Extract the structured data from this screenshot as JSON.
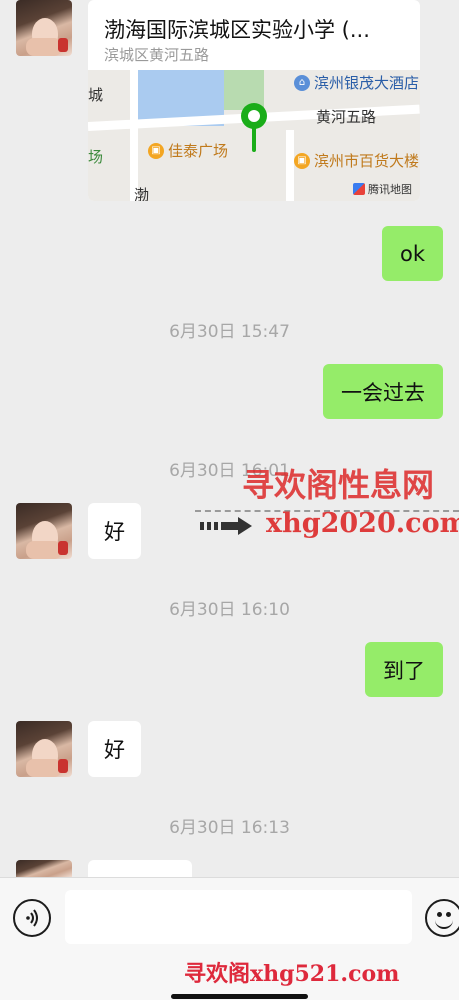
{
  "location": {
    "title": "渤海国际滨城区实验小学 (...",
    "subtitle": "滨城区黄河五路",
    "map_labels": {
      "road": "黄河五路",
      "poi_1": "滨州银茂大酒店",
      "poi_2": "佳泰广场",
      "poi_3": "滨州市百货大楼",
      "fragment_left": "城",
      "fragment_left2": "场",
      "fragment_bottom": "渤",
      "provider": "腾讯地图"
    }
  },
  "messages": [
    {
      "side": "right",
      "text": "ok"
    },
    {
      "type": "time",
      "text": "6月30日 15:47"
    },
    {
      "side": "right",
      "text": "一会过去"
    },
    {
      "type": "time",
      "text": "6月30日 16:01"
    },
    {
      "side": "left",
      "text": "好"
    },
    {
      "type": "time",
      "text": "6月30日 16:10"
    },
    {
      "side": "right",
      "text": "到了"
    },
    {
      "side": "left",
      "text": "好"
    },
    {
      "type": "time",
      "text": "6月30日 16:13"
    }
  ],
  "watermark": {
    "line1": "寻欢阁性息网",
    "line2": "xhg2020.com",
    "line3": "寻欢阁xhg521.com"
  },
  "input": {
    "placeholder": ""
  },
  "colors": {
    "background": "#ededed",
    "sent_bubble": "#95ec69",
    "received_bubble": "#ffffff",
    "watermark": "#dc2828"
  }
}
